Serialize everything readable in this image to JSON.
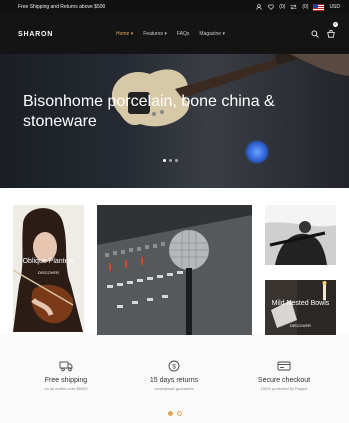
{
  "topbar": {
    "promo": "Free Shipping and Returns above $500",
    "wishlist_count": "(0)",
    "compare_count": "(0)",
    "currency": "USD"
  },
  "nav": {
    "logo": "SHARON",
    "menu": [
      {
        "label": "Home ▾",
        "active": true
      },
      {
        "label": "Features ▾",
        "active": false
      },
      {
        "label": "FAQs",
        "active": false
      },
      {
        "label": "Magazine ▾",
        "active": false
      }
    ],
    "cart_count": "0"
  },
  "hero": {
    "title": "Bisonhome porcelain, bone china & stoneware"
  },
  "cards": {
    "left": {
      "caption": "Oblique Planters",
      "sub": "DISCOVER"
    },
    "right_bottom": {
      "caption": "Mild Nested Bowls",
      "sub": "DISCOVER"
    }
  },
  "features": [
    {
      "icon": "truck-icon",
      "title": "Free shipping",
      "subtitle": "on all orders over $5000"
    },
    {
      "icon": "dollar-icon",
      "title": "15 days returns",
      "subtitle": "moneyback guarantee"
    },
    {
      "icon": "card-icon",
      "title": "Secure checkout",
      "subtitle": "100% protected by Paypal"
    }
  ],
  "colors": {
    "accent": "#e6a35a",
    "dark": "#141414"
  }
}
